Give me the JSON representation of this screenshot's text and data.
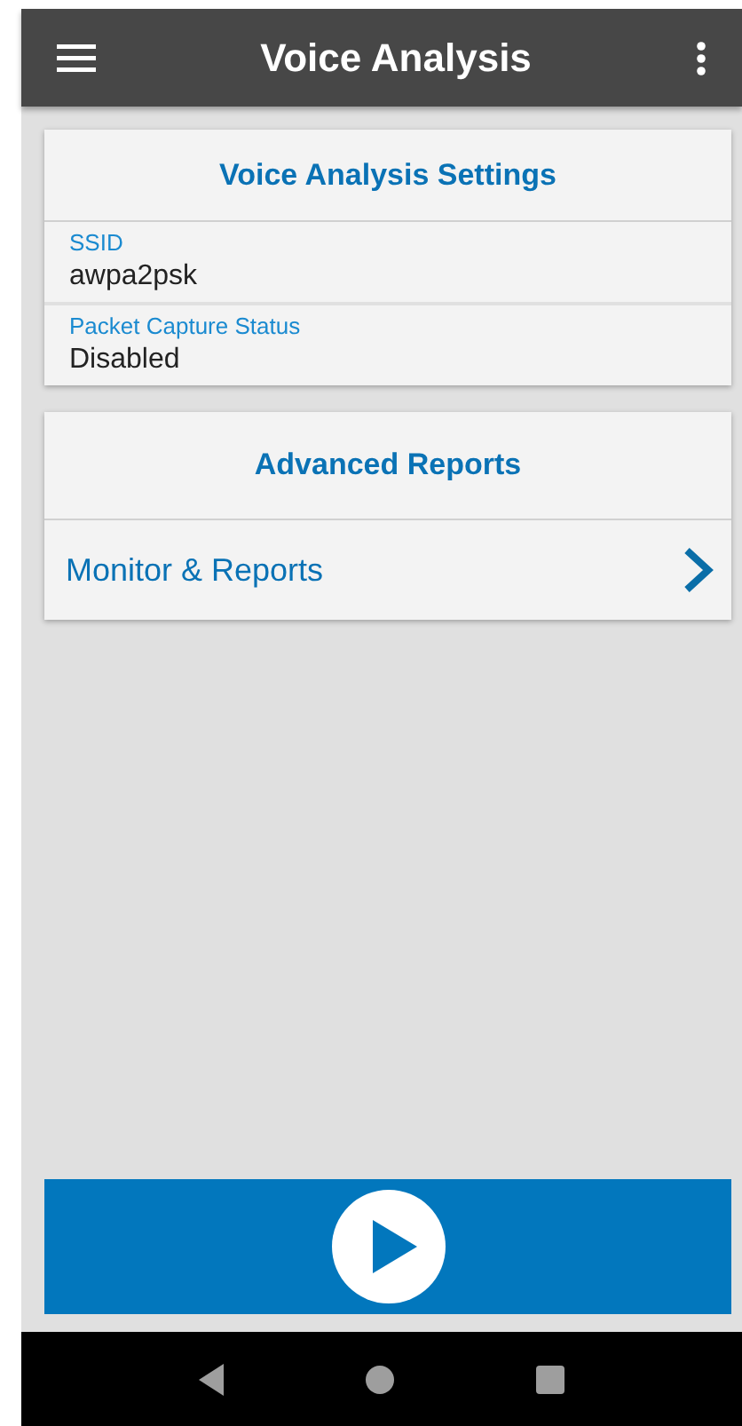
{
  "app_bar": {
    "title": "Voice Analysis"
  },
  "settings_card": {
    "title": "Voice Analysis Settings",
    "fields": [
      {
        "label": "SSID",
        "value": "awpa2psk"
      },
      {
        "label": "Packet Capture Status",
        "value": "Disabled"
      }
    ]
  },
  "reports_card": {
    "title": "Advanced Reports",
    "items": [
      {
        "label": "Monitor & Reports"
      }
    ]
  }
}
